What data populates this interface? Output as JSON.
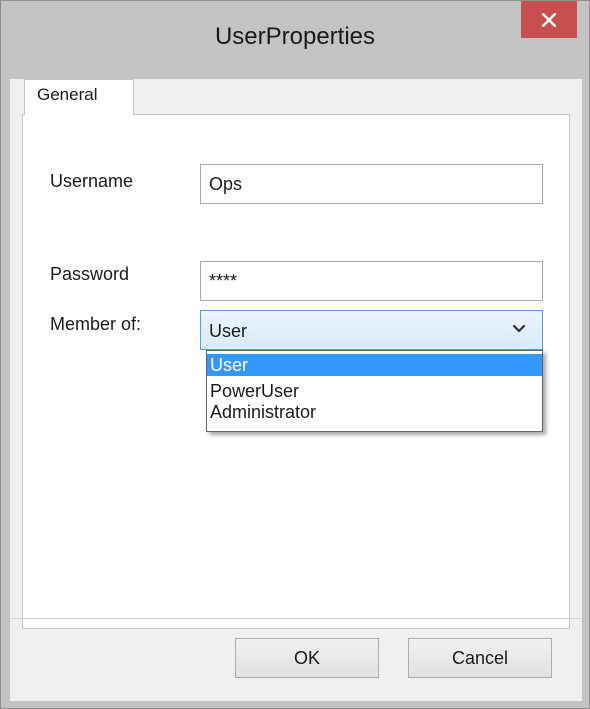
{
  "window": {
    "title": "UserProperties",
    "close_symbol": "✕"
  },
  "tabs": [
    {
      "label": "General",
      "active": true
    }
  ],
  "form": {
    "username": {
      "label": "Username",
      "value": "Ops"
    },
    "password": {
      "label": "Password",
      "value": "****"
    },
    "member_of": {
      "label": "Member of:",
      "selected": "User",
      "options": [
        "User",
        "PowerUser",
        "Administrator"
      ]
    }
  },
  "buttons": {
    "ok": "OK",
    "cancel": "Cancel"
  },
  "icons": {
    "close": "close-icon",
    "dropdown": "chevron-down-icon"
  },
  "colors": {
    "close_button": "#c74f50",
    "selection": "#3399ff",
    "combo_border": "#569de5"
  }
}
